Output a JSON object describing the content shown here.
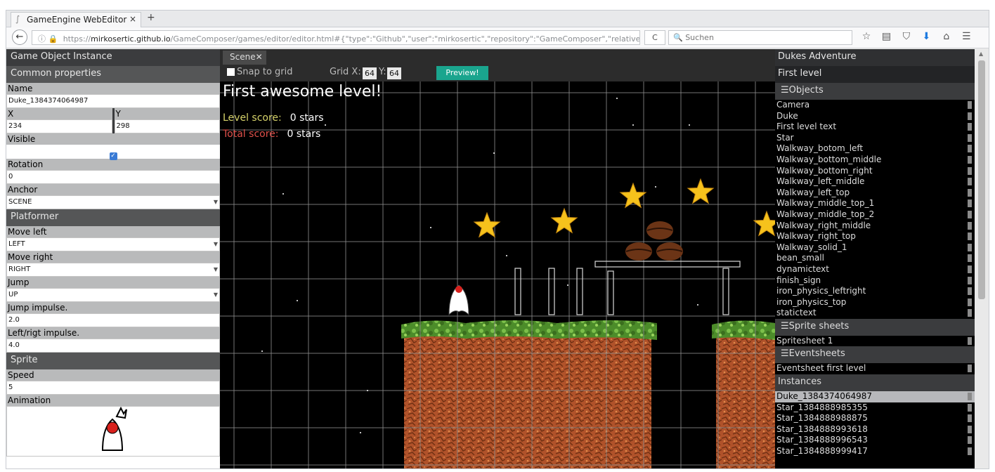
{
  "browser": {
    "tab_title": "GameEngine WebEditor",
    "tab_close": "×",
    "new_tab": "+",
    "url_prefix": "https://",
    "url_domain": "mirkosertic.github.io",
    "url_rest": "/GameComposer/games/editor/editor.html#{\"type\":\"Github\",\"user\":\"mirkosertic\",\"repository\":\"GameComposer\",\"relativePath\":\"",
    "reload_icon": "C",
    "search_placeholder": "Suchen"
  },
  "left_panel": {
    "header": "Game Object Instance",
    "common_header": "Common properties",
    "name_label": "Name",
    "name_value": "Duke_1384374064987",
    "x_label": "X",
    "x_value": "234",
    "y_label": "Y",
    "y_value": "298",
    "visible_label": "Visible",
    "visible_checked": true,
    "rotation_label": "Rotation",
    "rotation_value": "0",
    "anchor_label": "Anchor",
    "anchor_value": "SCENE",
    "platformer_header": "Platformer",
    "move_left_label": "Move left",
    "move_left_value": "LEFT",
    "move_right_label": "Move right",
    "move_right_value": "RIGHT",
    "jump_label": "Jump",
    "jump_value": "UP",
    "jump_impulse_label": "Jump impulse.",
    "jump_impulse_value": "2.0",
    "lr_impulse_label": "Left/rigt impulse.",
    "lr_impulse_value": "4.0",
    "sprite_header": "Sprite",
    "speed_label": "Speed",
    "speed_value": "5",
    "animation_label": "Animation"
  },
  "center": {
    "tab_label": "Scene",
    "tab_close": "✕",
    "snap_label": "Snap to grid",
    "grid_x_label": "Grid X:",
    "grid_x_value": "64",
    "grid_y_label": "Y:",
    "grid_y_value": "64",
    "preview_label": "Preview!",
    "level_title": "First awesome level!",
    "level_score_label": "Level score:",
    "level_score_value": "0 stars",
    "total_score_label": "Total score:",
    "total_score_value": "0 stars"
  },
  "right_panel": {
    "game_title": "Dukes Adventure",
    "level_name": "First level",
    "objects_header": "Objects",
    "objects": [
      "Camera",
      "Duke",
      "First level text",
      "Star",
      "Walkway_botom_left",
      "Walkway_bottom_middle",
      "Walkway_bottom_right",
      "Walkway_left_middle",
      "Walkway_left_top",
      "Walkway_middle_top_1",
      "Walkway_middle_top_2",
      "Walkway_right_middle",
      "Walkway_right_top",
      "Walkway_solid_1",
      "bean_small",
      "dynamictext",
      "finish_sign",
      "iron_physics_leftright",
      "iron_physics_top",
      "statictext"
    ],
    "sprite_sheets_header": "Sprite sheets",
    "sprite_sheets": [
      "Spritesheet 1"
    ],
    "eventsheets_header": "Eventsheets",
    "eventsheets": [
      "Eventsheet first level"
    ],
    "instances_header": "Instances",
    "instances": [
      "Duke_1384374064987",
      "Star_1384888985355",
      "Star_1384888988875",
      "Star_1384888993618",
      "Star_1384888996543",
      "Star_1384888999417"
    ],
    "selected_instance": "Duke_1384374064987"
  },
  "colors": {
    "accent_preview": "#1aa58e",
    "level_score": "#d6d26a",
    "total_score": "#e0504a",
    "star": "#f6c21c",
    "dirt": "#b0522a",
    "grass": "#4c8c2a"
  }
}
